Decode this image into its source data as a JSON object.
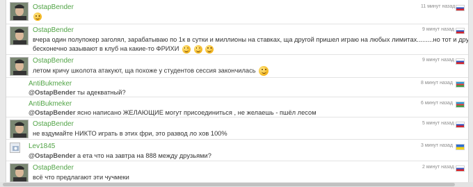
{
  "messages": [
    {
      "author": "OstapBender",
      "time": "11 минут назад",
      "flag": "ru",
      "text": ""
    },
    {
      "author": "OstapBender",
      "time": "9 минут назад",
      "flag": "ru",
      "text_line1": "вчера один полупокер заголял, зарабатываю по 1к в сутки и миллионы на ставках, ща другой пришел играю на любых лимитах.........но тот и другой",
      "text_line2": "бесконечно зазывают в клуб на какие-то ФРИХИ"
    },
    {
      "author": "OstapBender",
      "time": "9 минут назад",
      "flag": "ru",
      "text": "летом кричу школота атакуют, ща похоже у студентов сессия закончилась"
    },
    {
      "author": "AntiBukmeker",
      "time": "8 минут назад",
      "flag": "az",
      "mention": "@OstapBender",
      "text": " ты адекватный?"
    },
    {
      "author": "AntiBukmeker",
      "time": "6 минут назад",
      "flag": "az",
      "mention": "@OstapBender",
      "text": " ясно написано ЖЕЛАЮЩИЕ могут присоединиться , не желаешь - пшёл лесом"
    },
    {
      "author": "OstapBender",
      "time": "5 минут назад",
      "flag": "ru",
      "text": "не вздумайте НИКТО играть в этих фри, это развод ло хов 100%"
    },
    {
      "author": "Lev1845",
      "time": "3 минут назад",
      "flag": "ua",
      "mention": "@OstapBender",
      "text": " а ета что на завтра на 888 между друзьями?"
    },
    {
      "author": "OstapBender",
      "time": "2 минут назад",
      "flag": "ru",
      "text": "всё что предлагают эти чучмеки"
    }
  ],
  "colors": {
    "author": "#52a447",
    "text": "#333333",
    "time": "#8a8a8a"
  },
  "icons": {
    "ru": "russia-flag-icon",
    "az": "azerbaijan-flag-icon",
    "ua": "ukraine-flag-icon",
    "smiley": "smiley-icon"
  }
}
